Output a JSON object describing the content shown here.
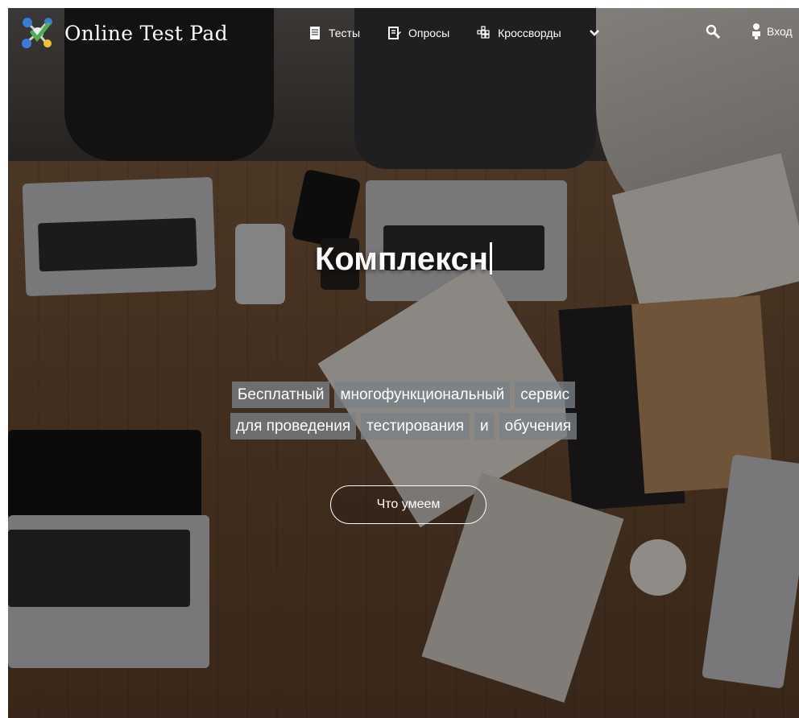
{
  "brand": {
    "name": "Online Test Pad",
    "logo_icon": "check-molecule-icon"
  },
  "nav": {
    "items": [
      {
        "label": "Тесты",
        "icon": "document-icon"
      },
      {
        "label": "Опросы",
        "icon": "poll-icon"
      },
      {
        "label": "Кроссворды",
        "icon": "crossword-icon"
      }
    ],
    "more_icon": "chevron-down-icon",
    "search_icon": "search-icon",
    "login_label": "Вход",
    "login_icon": "person-icon"
  },
  "hero": {
    "title": "Комплексн",
    "tagline_line1": [
      "Бесплатный",
      "многофункциональный",
      "сервис"
    ],
    "tagline_line2": [
      "для проведения",
      "тестирования",
      "и",
      "обучения"
    ],
    "cta_label": "Что умеем"
  },
  "colors": {
    "tag_background": "#78808a",
    "text": "#ffffff"
  }
}
